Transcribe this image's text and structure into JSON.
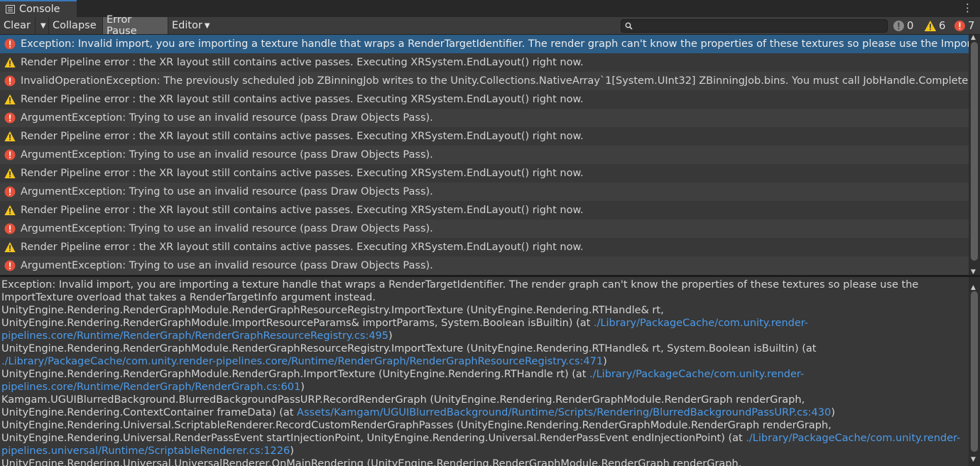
{
  "tab": {
    "title": "Console"
  },
  "toolbar": {
    "clear_label": "Clear",
    "collapse_label": "Collapse",
    "error_pause_label": "Error Pause",
    "editor_label": "Editor",
    "search_placeholder": ""
  },
  "counters": {
    "info": "0",
    "warnings": "6",
    "errors": "7"
  },
  "colors": {
    "selected_row": "#2c5d87",
    "error": "#e8503a",
    "warning": "#f5c518",
    "link": "#4c9bea"
  },
  "entries": [
    {
      "type": "error",
      "text": "Exception: Invalid import, you are importing a texture handle that wraps a RenderTargetIdentifier. The render graph can't know the properties of these textures so please use the ImportTexture overload that takes a RenderTargetInfo argument instead."
    },
    {
      "type": "warning",
      "text": "Render Pipeline error : the XR layout still contains active passes. Executing XRSystem.EndLayout() right now."
    },
    {
      "type": "error",
      "text": "InvalidOperationException: The previously scheduled job ZBinningJob writes to the Unity.Collections.NativeArray`1[System.UInt32] ZBinningJob.bins. You must call JobHandle.Complete() on the job ZBinningJob, before you can deallocate the Unity.Collections.NativeArray`1[System.UInt32] safely."
    },
    {
      "type": "warning",
      "text": "Render Pipeline error : the XR layout still contains active passes. Executing XRSystem.EndLayout() right now."
    },
    {
      "type": "error",
      "text": "ArgumentException: Trying to use an invalid resource (pass Draw Objects Pass)."
    },
    {
      "type": "warning",
      "text": "Render Pipeline error : the XR layout still contains active passes. Executing XRSystem.EndLayout() right now."
    },
    {
      "type": "error",
      "text": "ArgumentException: Trying to use an invalid resource (pass Draw Objects Pass)."
    },
    {
      "type": "warning",
      "text": "Render Pipeline error : the XR layout still contains active passes. Executing XRSystem.EndLayout() right now."
    },
    {
      "type": "error",
      "text": "ArgumentException: Trying to use an invalid resource (pass Draw Objects Pass)."
    },
    {
      "type": "warning",
      "text": "Render Pipeline error : the XR layout still contains active passes. Executing XRSystem.EndLayout() right now."
    },
    {
      "type": "error",
      "text": "ArgumentException: Trying to use an invalid resource (pass Draw Objects Pass)."
    },
    {
      "type": "warning",
      "text": "Render Pipeline error : the XR layout still contains active passes. Executing XRSystem.EndLayout() right now."
    },
    {
      "type": "error",
      "text": "ArgumentException: Trying to use an invalid resource (pass Draw Objects Pass)."
    }
  ],
  "detail": {
    "message": "Exception: Invalid import, you are importing a texture handle that wraps a RenderTargetIdentifier. The render graph can't know the properties of these textures so please use the ImportTexture overload that takes a RenderTargetInfo argument instead.",
    "stack": [
      {
        "text": "UnityEngine.Rendering.RenderGraphModule.RenderGraphResourceRegistry.ImportTexture (UnityEngine.Rendering.RTHandle& rt, UnityEngine.Rendering.RenderGraphModule.ImportResourceParams& importParams, System.Boolean isBuiltin) (at ",
        "link": "./Library/PackageCache/com.unity.render-pipelines.core/Runtime/RenderGraph/RenderGraphResourceRegistry.cs:495",
        "tail": ")"
      },
      {
        "text": "UnityEngine.Rendering.RenderGraphModule.RenderGraphResourceRegistry.ImportTexture (UnityEngine.Rendering.RTHandle& rt, System.Boolean isBuiltin) (at ",
        "link": "./Library/PackageCache/com.unity.render-pipelines.core/Runtime/RenderGraph/RenderGraphResourceRegistry.cs:471",
        "tail": ")"
      },
      {
        "text": "UnityEngine.Rendering.RenderGraphModule.RenderGraph.ImportTexture (UnityEngine.Rendering.RTHandle rt) (at ",
        "link": "./Library/PackageCache/com.unity.render-pipelines.core/Runtime/RenderGraph/RenderGraph.cs:601",
        "tail": ")"
      },
      {
        "text": "Kamgam.UGUIBlurredBackground.BlurredBackgroundPassURP.RecordRenderGraph (UnityEngine.Rendering.RenderGraphModule.RenderGraph renderGraph, UnityEngine.Rendering.ContextContainer frameData) (at ",
        "link": "Assets/Kamgam/UGUIBlurredBackground/Runtime/Scripts/Rendering/BlurredBackgroundPassURP.cs:430",
        "tail": ")"
      },
      {
        "text": "UnityEngine.Rendering.Universal.ScriptableRenderer.RecordCustomRenderGraphPasses (UnityEngine.Rendering.RenderGraphModule.RenderGraph renderGraph, UnityEngine.Rendering.Universal.RenderPassEvent startInjectionPoint, UnityEngine.Rendering.Universal.RenderPassEvent endInjectionPoint) (at ",
        "link": "./Library/PackageCache/com.unity.render-pipelines.universal/Runtime/ScriptableRenderer.cs:1226",
        "tail": ")"
      },
      {
        "text": "UnityEngine.Rendering.Universal.UniversalRenderer.OnMainRendering (UnityEngine.Rendering.RenderGraphModule.RenderGraph renderGraph, UnityEngine.Rendering.ScriptableRenderContext",
        "link": "",
        "tail": ""
      }
    ]
  }
}
